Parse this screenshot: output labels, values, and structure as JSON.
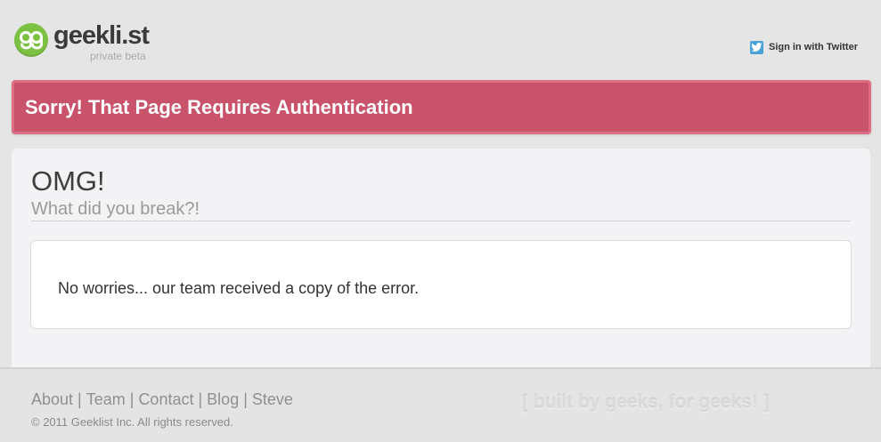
{
  "header": {
    "logo_text": "geekli.st",
    "logo_subtitle": "private beta",
    "signin_label": "Sign in with Twitter",
    "signin_icon": "twitter-icon"
  },
  "alert": {
    "message": "Sorry! That Page Requires Authentication",
    "color": "#c8536a"
  },
  "main": {
    "title": "OMG!",
    "subtitle": "What did you break?!",
    "message": "No worries... our team received a copy of the error."
  },
  "footer": {
    "links": [
      "About",
      "Team",
      "Contact",
      "Blog",
      "Steve"
    ],
    "separator": "|",
    "copyright": "© 2011 Geeklist Inc. All rights reserved.",
    "tagline": "[ built by geeks, for geeks! ]"
  },
  "colors": {
    "brand_green": "#7cc142",
    "alert_red": "#c8536a",
    "background": "#e6e5e6"
  }
}
